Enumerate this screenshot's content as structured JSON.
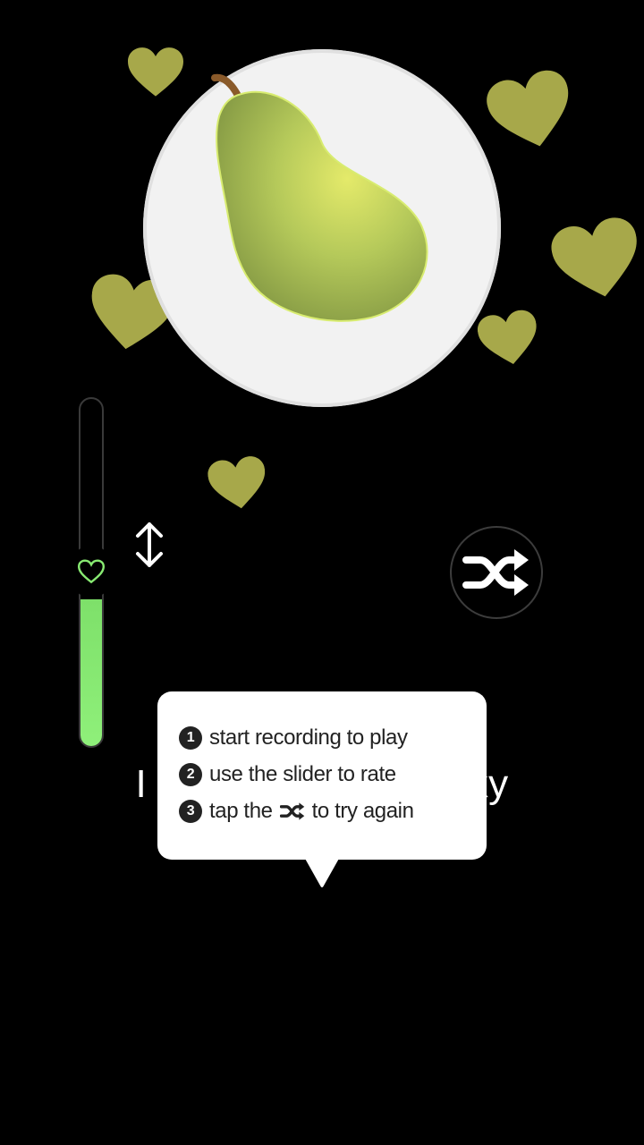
{
  "caption": "I don't think I'm picky",
  "instructions": {
    "step1": {
      "number": "1",
      "text": "start recording to play"
    },
    "step2": {
      "number": "2",
      "text": "use the slider to rate"
    },
    "step3": {
      "number": "3",
      "before": "tap the",
      "after": "to try again"
    }
  },
  "slider": {
    "icon": "heart-outline-icon",
    "level": 0.42
  },
  "icons": {
    "pear": "pear-icon",
    "shuffle": "shuffle-icon",
    "updown": "up-down-arrow-icon",
    "heart": "heart-icon"
  },
  "colors": {
    "background": "#000000",
    "heart": "#a7a84a",
    "slider_fill": "#88ea72",
    "plate": "#f2f2f2",
    "pear": "#b5c95a"
  }
}
